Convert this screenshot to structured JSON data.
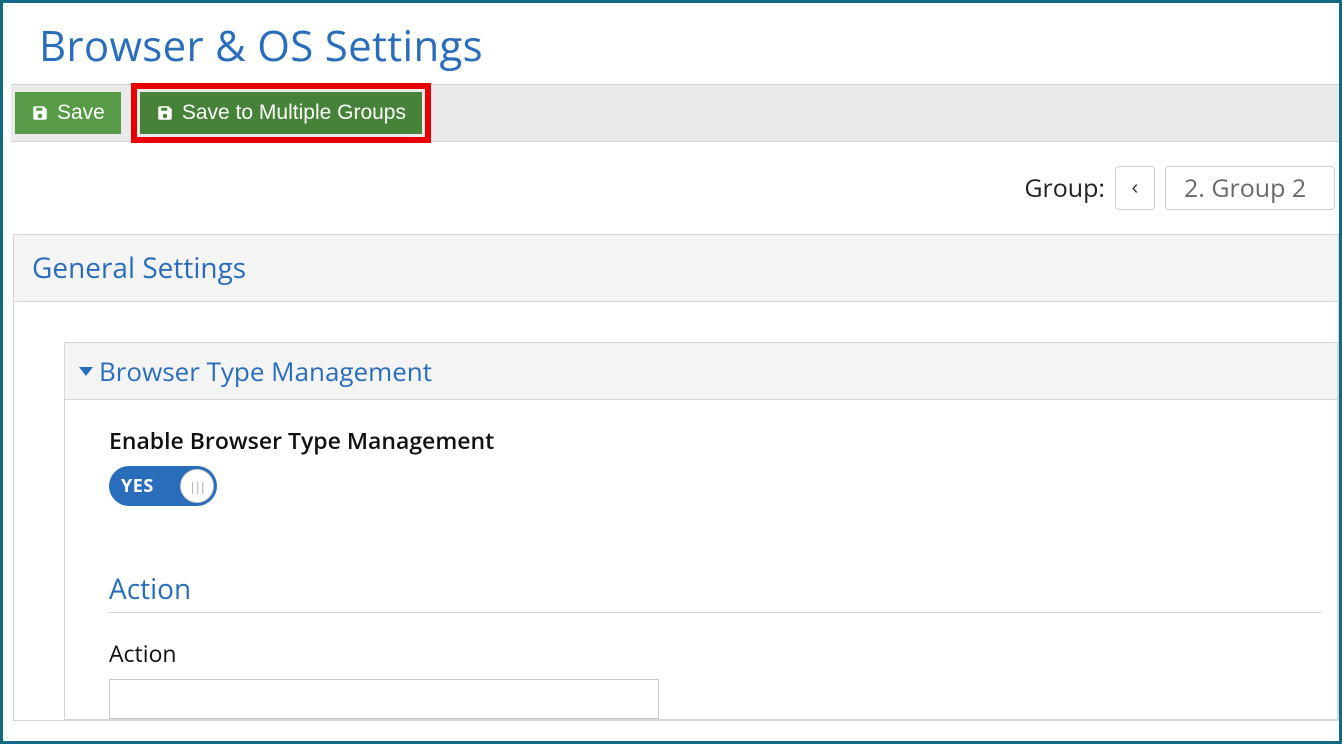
{
  "page": {
    "title": "Browser & OS Settings"
  },
  "toolbar": {
    "save_label": "Save",
    "save_multi_label": "Save to Multiple Groups"
  },
  "group_selector": {
    "label": "Group:",
    "prev_icon": "‹",
    "current": "2. Group 2"
  },
  "panel": {
    "general_title": "General Settings",
    "browser_mgmt": {
      "title": "Browser Type Management",
      "enable_label": "Enable Browser Type Management",
      "toggle_value": "YES"
    },
    "action": {
      "section_title": "Action",
      "field_label": "Action"
    }
  }
}
